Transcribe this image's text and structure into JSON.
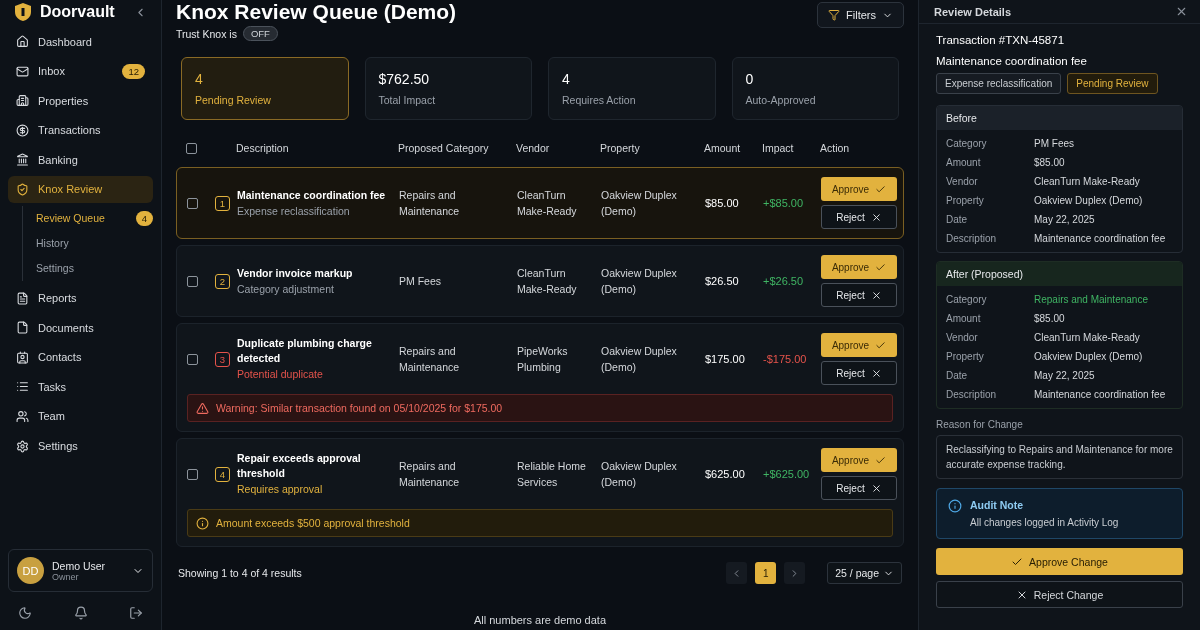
{
  "brand": {
    "name": "Doorvault"
  },
  "nav": [
    {
      "label": "Dashboard",
      "selected": false
    },
    {
      "label": "Inbox",
      "selected": false,
      "badge": "12"
    },
    {
      "label": "Properties",
      "selected": false
    },
    {
      "label": "Transactions",
      "selected": false
    },
    {
      "label": "Banking",
      "selected": false
    },
    {
      "label": "Knox Review",
      "selected": true,
      "expanded": true,
      "children": [
        {
          "label": "Review Queue",
          "selected": true,
          "badge": "4"
        },
        {
          "label": "History",
          "selected": false
        },
        {
          "label": "Settings",
          "selected": false
        }
      ]
    },
    {
      "label": "Reports",
      "selected": false
    },
    {
      "label": "Documents",
      "selected": false
    },
    {
      "label": "Contacts",
      "selected": false
    },
    {
      "label": "Tasks",
      "selected": false
    },
    {
      "label": "Team",
      "selected": false
    },
    {
      "label": "Settings",
      "selected": false
    }
  ],
  "user": {
    "initials": "DD",
    "name": "Demo User",
    "role": "Owner"
  },
  "header": {
    "title": "Knox Review Queue (Demo)",
    "trust_label": "Trust Knox is",
    "trust_state": "OFF",
    "filters": "Filters"
  },
  "stats": [
    {
      "value": "4",
      "label": "Pending Review",
      "selected": true
    },
    {
      "value": "$762.50",
      "label": "Total Impact",
      "selected": false
    },
    {
      "value": "4",
      "label": "Requires Action",
      "selected": false
    },
    {
      "value": "0",
      "label": "Auto-Approved",
      "selected": false
    }
  ],
  "table": {
    "select_all_checked": false,
    "columns": [
      "Description",
      "Proposed Category",
      "Vendor",
      "Property",
      "Amount",
      "Impact",
      "Action"
    ],
    "rows": [
      {
        "number": {
          "text": "1",
          "color": "#e2b23e"
        },
        "selected": true,
        "checked": false,
        "title": "Maintenance coordination fee",
        "subtitle": {
          "text": "Expense reclassification",
          "kind": "muted"
        },
        "category": "Repairs and Maintenance",
        "vendor": "CleanTurn Make-Ready",
        "property": "Oakview Duplex (Demo)",
        "amount": "$85.00",
        "impact": {
          "text": "+$85.00",
          "kind": "gain"
        },
        "approve": "Approve",
        "reject": "Reject"
      },
      {
        "number": {
          "text": "2",
          "color": "#e2b23e"
        },
        "selected": false,
        "checked": false,
        "title": "Vendor invoice markup",
        "subtitle": {
          "text": "Category adjustment",
          "kind": "muted"
        },
        "category": "PM Fees",
        "vendor": "CleanTurn Make-Ready",
        "property": "Oakview Duplex (Demo)",
        "amount": "$26.50",
        "impact": {
          "text": "+$26.50",
          "kind": "gain"
        },
        "approve": "Approve",
        "reject": "Reject"
      },
      {
        "number": {
          "text": "3",
          "color": "#e5534b"
        },
        "selected": false,
        "checked": false,
        "title": "Duplicate plumbing charge detected",
        "subtitle": {
          "text": "Potential duplicate",
          "kind": "danger"
        },
        "category": "Repairs and Maintenance",
        "vendor": "PipeWorks Plumbing",
        "property": "Oakview Duplex (Demo)",
        "amount": "$175.00",
        "impact": {
          "text": "-$175.00",
          "kind": "loss"
        },
        "approve": "Approve",
        "reject": "Reject",
        "alert": {
          "kind": "warning",
          "text": "Warning: Similar transaction found on 05/10/2025 for $175.00"
        }
      },
      {
        "number": {
          "text": "4",
          "color": "#e2b23e"
        },
        "selected": false,
        "checked": false,
        "title": "Repair exceeds approval threshold",
        "subtitle": {
          "text": "Requires approval",
          "kind": "warning"
        },
        "category": "Repairs and Maintenance",
        "vendor": "Reliable Home Services",
        "property": "Oakview Duplex (Demo)",
        "amount": "$625.00",
        "impact": {
          "text": "+$625.00",
          "kind": "gain"
        },
        "approve": "Approve",
        "reject": "Reject",
        "alert": {
          "kind": "info",
          "text": "Amount exceeds $500 approval threshold"
        }
      }
    ]
  },
  "pagination": {
    "summary": "Showing 1 to 4 of 4 results",
    "pages": [
      {
        "label": "1",
        "selected": true
      }
    ],
    "page_size": "25 / page"
  },
  "footer_note": "All numbers are demo data",
  "details": {
    "title": "Review Details",
    "transaction": "Transaction #TXN-45871",
    "name": "Maintenance coordination fee",
    "tags": [
      {
        "label": "Expense reclassification",
        "kind": "neutral"
      },
      {
        "label": "Pending Review",
        "kind": "status"
      }
    ],
    "sections": [
      {
        "kind": "before",
        "title": "Before",
        "rows": [
          {
            "label": "Category",
            "value": "PM Fees",
            "changed": false
          },
          {
            "label": "Amount",
            "value": "$85.00",
            "changed": false
          },
          {
            "label": "Vendor",
            "value": "CleanTurn Make-Ready",
            "changed": false
          },
          {
            "label": "Property",
            "value": "Oakview Duplex (Demo)",
            "changed": false
          },
          {
            "label": "Date",
            "value": "May 22, 2025",
            "changed": false
          },
          {
            "label": "Description",
            "value": "Maintenance coordination fee",
            "changed": false
          }
        ]
      },
      {
        "kind": "after",
        "title": "After (Proposed)",
        "rows": [
          {
            "label": "Category",
            "value": "Repairs and Maintenance",
            "changed": true
          },
          {
            "label": "Amount",
            "value": "$85.00",
            "changed": false
          },
          {
            "label": "Vendor",
            "value": "CleanTurn Make-Ready",
            "changed": false
          },
          {
            "label": "Property",
            "value": "Oakview Duplex (Demo)",
            "changed": false
          },
          {
            "label": "Date",
            "value": "May 22, 2025",
            "changed": false
          },
          {
            "label": "Description",
            "value": "Maintenance coordination fee",
            "changed": false
          }
        ]
      }
    ],
    "reason_label": "Reason for Change",
    "reason": "Reclassifying to Repairs and Maintenance for more accurate expense tracking.",
    "audit": {
      "title": "Audit Note",
      "text": "All changes logged in Activity Log"
    },
    "approve": "Approve Change",
    "reject": "Reject Change"
  }
}
